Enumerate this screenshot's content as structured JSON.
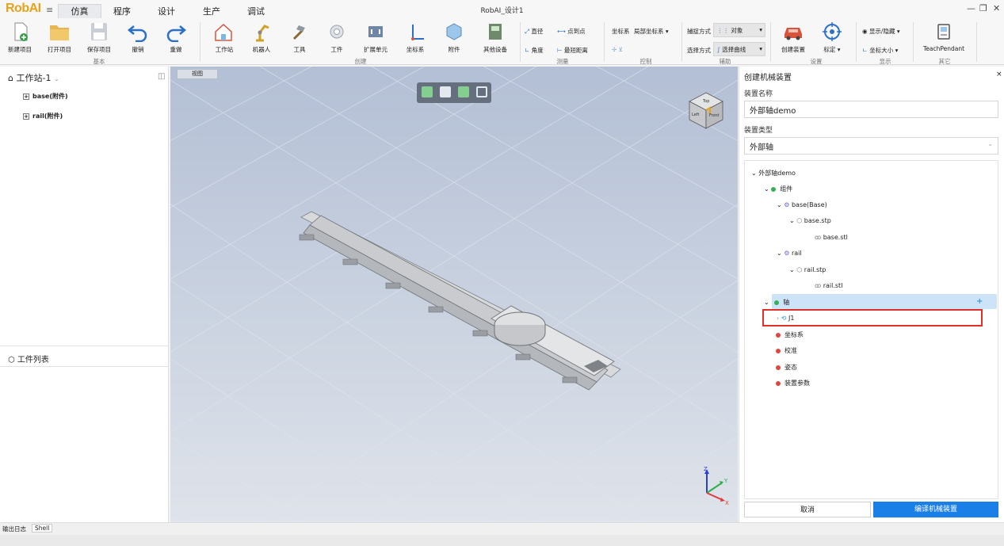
{
  "app": {
    "logo": "RobAI",
    "doc_title": "RobAI_设计1",
    "window_controls": {
      "minimize": "—",
      "restore": "❐",
      "close": "✕"
    }
  },
  "menu_tabs": [
    "仿真",
    "程序",
    "设计",
    "生产",
    "调试"
  ],
  "ribbon": {
    "buttons": {
      "new_project": "新建项目",
      "open_project": "打开项目",
      "save_project": "保存项目",
      "undo": "撤销",
      "redo": "重做",
      "workstation": "工作站",
      "robot": "机器人",
      "tool": "工具",
      "workpiece": "工件",
      "expansion_unit": "扩展单元",
      "coord_system": "坐标系",
      "attachment": "附件",
      "other_devices": "其他设备",
      "create_device": "创建装置",
      "calibrate": "标定",
      "teach_pendant": "TeachPendant"
    },
    "measure": {
      "diameter": "直径",
      "point_to_point": "点到点",
      "angle": "角度",
      "shortest_distance": "最短距离"
    },
    "control": {
      "coord_label": "坐标系",
      "coord_value": "局部坐标系"
    },
    "assist": {
      "capture_label": "捕捉方式",
      "capture_value": "对象",
      "select_label": "选择方式",
      "select_value": "选择曲线"
    },
    "display": {
      "show_hide": "显示/隐藏",
      "coord_size": "坐标大小"
    },
    "groups": {
      "basic": "基本",
      "create": "创建",
      "measure": "测量",
      "control": "控制",
      "assist": "辅助",
      "settings": "设置",
      "display": "显示",
      "other": "其它"
    }
  },
  "left_panel": {
    "station_title": "工作站-1",
    "tree": [
      "base(附件)",
      "rail(附件)"
    ],
    "workpiece_title": "工件列表"
  },
  "viewport": {
    "tab": "视图",
    "cube": {
      "top": "Top",
      "left": "Left",
      "front": "Front"
    },
    "axes": {
      "x": "X",
      "y": "Y",
      "z": "Z"
    }
  },
  "right_panel": {
    "title": "创建机械装置",
    "name_label": "装置名称",
    "name_value": "外部轴demo",
    "type_label": "装置类型",
    "type_value": "外部轴",
    "tree": {
      "root": "外部轴demo",
      "components": "组件",
      "base": "base(Base)",
      "base_stp": "base.stp",
      "base_stl": "base.stl",
      "rail": "rail",
      "rail_stp": "rail.stp",
      "rail_stl": "rail.stl",
      "axis": "轴",
      "axis_add": "+",
      "j1": "J1",
      "coord": "坐标系",
      "calibration": "校准",
      "pose": "姿态",
      "params": "装置参数"
    },
    "cancel": "取消",
    "compile": "编译机械装置"
  },
  "bottom_tabs": [
    "输出日志",
    "Shell"
  ],
  "colors": {
    "accent": "#1a7fe6",
    "green_dot": "#35b05a",
    "red_dot": "#e0453f",
    "selection": "#cde3f7",
    "highlight_box": "#e0302a",
    "logo": "#e6a319"
  }
}
